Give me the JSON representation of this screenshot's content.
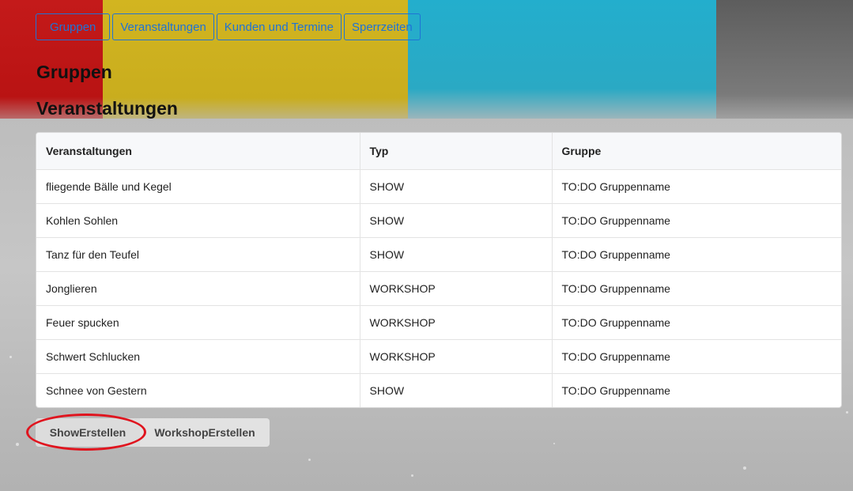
{
  "nav": {
    "tabs": [
      {
        "label": "Gruppen",
        "active": true
      },
      {
        "label": "Veranstaltungen"
      },
      {
        "label": "Kunden und Termine"
      },
      {
        "label": "Sperrzeiten"
      }
    ]
  },
  "headings": {
    "groups": "Gruppen",
    "events": "Veranstaltungen"
  },
  "table": {
    "headers": [
      "Veranstaltungen",
      "Typ",
      "Gruppe"
    ],
    "rows": [
      [
        "fliegende Bälle und Kegel",
        "SHOW",
        "TO:DO Gruppenname"
      ],
      [
        "Kohlen Sohlen",
        "SHOW",
        "TO:DO Gruppenname"
      ],
      [
        "Tanz für den Teufel",
        "SHOW",
        "TO:DO Gruppenname"
      ],
      [
        "Jonglieren",
        "WORKSHOP",
        "TO:DO Gruppenname"
      ],
      [
        "Feuer spucken",
        "WORKSHOP",
        "TO:DO Gruppenname"
      ],
      [
        "Schwert Schlucken",
        "WORKSHOP",
        "TO:DO Gruppenname"
      ],
      [
        "Schnee von Gestern",
        "SHOW",
        "TO:DO Gruppenname"
      ]
    ]
  },
  "buttons": {
    "show_create": "ShowErstellen",
    "workshop_create": "WorkshopErstellen"
  },
  "colors": {
    "link": "#1f73d6",
    "highlight": "#e0141e"
  }
}
